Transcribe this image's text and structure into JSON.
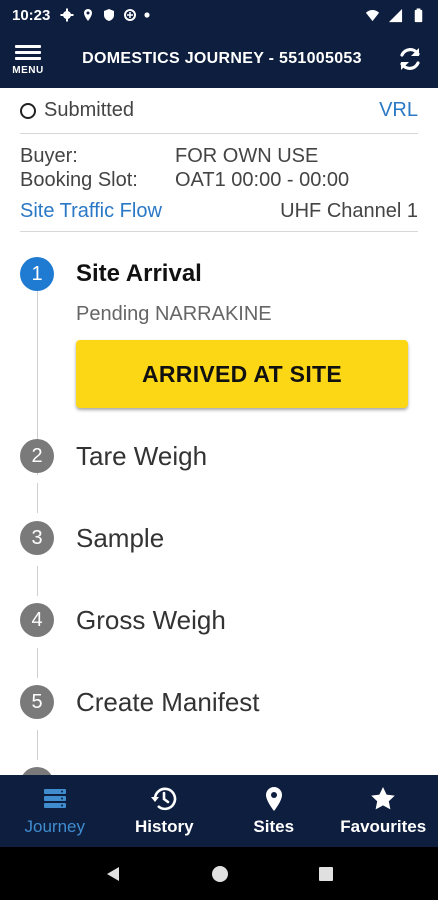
{
  "status_bar": {
    "time": "10:23"
  },
  "header": {
    "menu_label": "MENU",
    "title": "DOMESTICS JOURNEY - 551005053"
  },
  "summary": {
    "status": "Submitted",
    "vrl_link": "VRL",
    "buyer_key": "Buyer:",
    "buyer_value": "FOR OWN USE",
    "slot_key": "Booking Slot:",
    "slot_value": "OAT1 00:00 - 00:00",
    "traffic_link": "Site Traffic Flow",
    "uhf": "UHF Channel 1"
  },
  "steps": [
    {
      "num": "1",
      "label": "Site Arrival",
      "active": true
    },
    {
      "num": "2",
      "label": "Tare Weigh"
    },
    {
      "num": "3",
      "label": "Sample"
    },
    {
      "num": "4",
      "label": "Gross Weigh"
    },
    {
      "num": "5",
      "label": "Create Manifest"
    }
  ],
  "current_step": {
    "pending": "Pending NARRAKINE",
    "action_button": "ARRIVED AT SITE"
  },
  "bottom_nav": [
    {
      "label": "Journey",
      "icon": "server-icon",
      "active": true
    },
    {
      "label": "History",
      "icon": "history-icon"
    },
    {
      "label": "Sites",
      "icon": "map-pin-icon"
    },
    {
      "label": "Favourites",
      "icon": "star-icon"
    }
  ],
  "colors": {
    "navy": "#0e1e3e",
    "accent_blue": "#1f7bd2",
    "button_yellow": "#fcd715",
    "link_blue": "#2a78c6"
  }
}
